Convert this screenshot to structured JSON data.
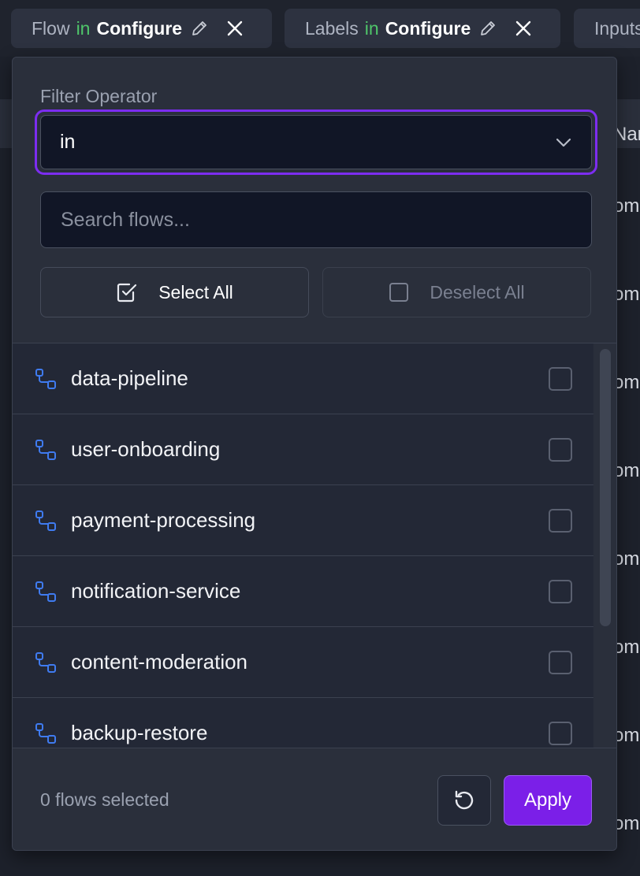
{
  "filter_chips": [
    {
      "field": "Flow",
      "operator": "in",
      "value": "Configure"
    },
    {
      "field": "Labels",
      "operator": "in",
      "value": "Configure"
    },
    {
      "field": "Inputs",
      "operator": "",
      "value": ""
    }
  ],
  "background_table": {
    "header_fragment": "Nan",
    "cell_fragment": "om"
  },
  "panel": {
    "operator_label": "Filter Operator",
    "operator_value": "in",
    "search_placeholder": "Search flows...",
    "select_all_label": "Select All",
    "deselect_all_label": "Deselect All",
    "flows": [
      {
        "name": "data-pipeline",
        "checked": false
      },
      {
        "name": "user-onboarding",
        "checked": false
      },
      {
        "name": "payment-processing",
        "checked": false
      },
      {
        "name": "notification-service",
        "checked": false
      },
      {
        "name": "content-moderation",
        "checked": false
      },
      {
        "name": "backup-restore",
        "checked": false
      }
    ],
    "selected_count_text": "0 flows selected",
    "apply_label": "Apply"
  },
  "colors": {
    "accent": "#7b1fe8",
    "operator_green": "#4fc56a",
    "flow_icon_blue": "#3f7bf0"
  }
}
